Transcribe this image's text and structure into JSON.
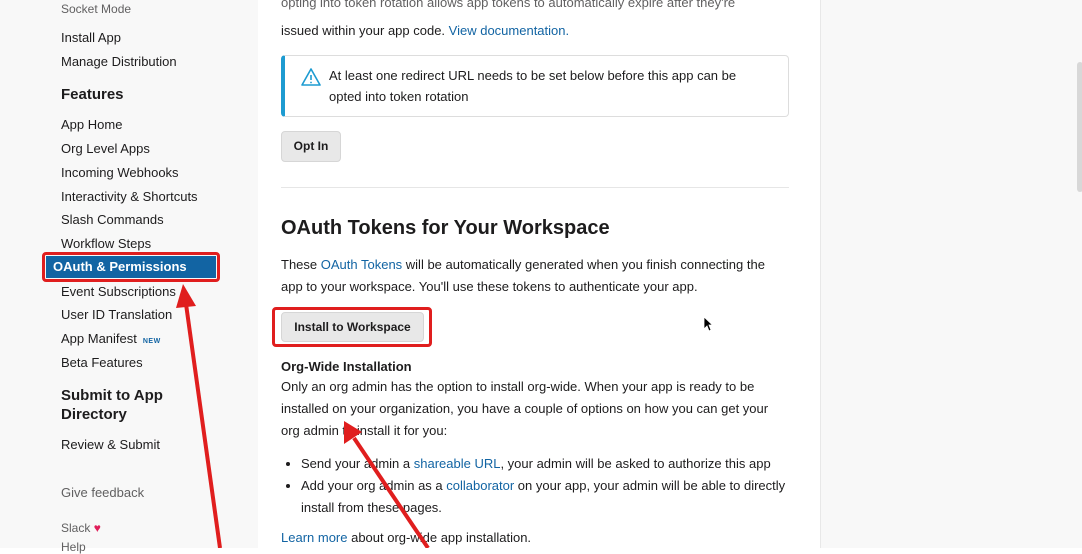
{
  "sidebar": {
    "top_partial": "Socket Mode",
    "settings_items": [
      "Install App",
      "Manage Distribution"
    ],
    "features_heading": "Features",
    "features_items": [
      "App Home",
      "Org Level Apps",
      "Incoming Webhooks",
      "Interactivity & Shortcuts",
      "Slash Commands",
      "Workflow Steps",
      "OAuth & Permissions",
      "Event Subscriptions",
      "User ID Translation",
      "App Manifest",
      "Beta Features"
    ],
    "new_badge": "NEW",
    "submit_heading_1": "Submit to App",
    "submit_heading_2": "Directory",
    "submit_items": [
      "Review & Submit"
    ],
    "give_feedback": "Give feedback",
    "slack_label": "Slack",
    "heart": "♥",
    "bottom_partial": "Help"
  },
  "main": {
    "top_partial_line": "opting into token rotation allows app tokens to automatically expire after they're",
    "top_line_2": "issued within your app code. ",
    "view_docs_link": "View documentation.",
    "alert_text": "At least one redirect URL needs to be set below before this app can be opted into token rotation",
    "opt_in_button": "Opt In",
    "oauth_heading": "OAuth Tokens for Your Workspace",
    "oauth_desc_1": "These ",
    "oauth_desc_link": "OAuth Tokens",
    "oauth_desc_2": " will be automatically generated when you finish connecting the",
    "oauth_desc_3": "app to your workspace. You'll use these tokens to authenticate your app.",
    "install_button": "Install to Workspace",
    "org_heading": "Org-Wide Installation",
    "org_p1": "Only an org admin has the option to install org-wide. When your app is ready to be",
    "org_p2": "installed on your organization, you have a couple of options on how you can get your",
    "org_p3": "org admin to install it for you:",
    "bullet1_a": "Send your admin a ",
    "bullet1_link": "shareable URL",
    "bullet1_b": ", your admin will be asked to authorize this app",
    "bullet2_a": "Add your org admin as a ",
    "bullet2_link": "collaborator",
    "bullet2_b": " on your app, your admin will be able to directly install from these pages.",
    "learn_more_link": "Learn more",
    "learn_more_rest": " about org-wide app installation."
  },
  "colors": {
    "accent": "#1264a3",
    "highlight": "#e01e1e",
    "alert_border": "#1d9bd1"
  }
}
